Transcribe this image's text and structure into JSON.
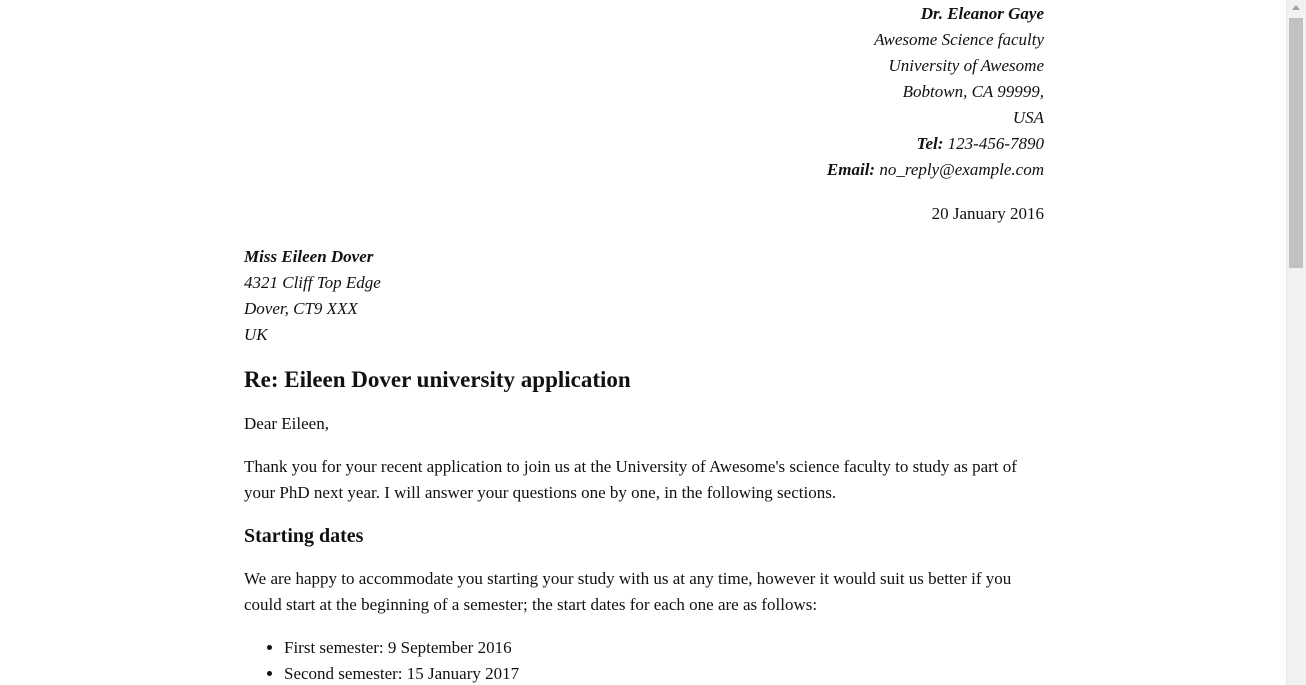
{
  "sender": {
    "name": "Dr. Eleanor Gaye",
    "faculty": "Awesome Science faculty",
    "university": "University of Awesome",
    "city": "Bobtown, CA 99999,",
    "country": "USA",
    "tel_label": "Tel:",
    "tel_value": "123-456-7890",
    "email_label": "Email:",
    "email_value": "no_reply@example.com"
  },
  "date": "20 January 2016",
  "recipient": {
    "name": "Miss Eileen Dover",
    "street": "4321 Cliff Top Edge",
    "city": "Dover, CT9 XXX",
    "country": "UK"
  },
  "heading": "Re: Eileen Dover university application",
  "greeting": "Dear Eileen,",
  "intro": "Thank you for your recent application to join us at the University of Awesome's science faculty to study as part of your PhD next year. I will answer your questions one by one, in the following sections.",
  "section": {
    "title": "Starting dates",
    "text": "We are happy to accommodate you starting your study with us at any time, however it would suit us better if you could start at the beginning of a semester; the start dates for each one are as follows:",
    "items": [
      "First semester: 9 September 2016",
      "Second semester: 15 January 2017"
    ]
  }
}
